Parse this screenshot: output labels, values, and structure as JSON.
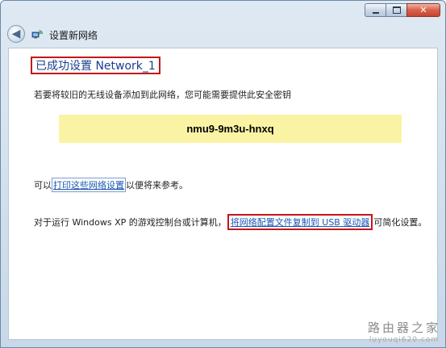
{
  "window": {
    "title": "设置新网络",
    "controls": {
      "minimize": "minimize-icon",
      "maximize": "maximize-icon",
      "close": "close-icon"
    }
  },
  "content": {
    "heading": "已成功设置 Network_1",
    "info": "若要将较旧的无线设备添加到此网络，您可能需要提供此安全密钥",
    "security_key": "nmu9-9m3u-hnxq",
    "print_line": {
      "before": "可以",
      "link": "打印这些网络设置",
      "after": "以便将来参考。"
    },
    "usb_line": {
      "before": "对于运行 Windows XP 的游戏控制台或计算机，",
      "link": "将网络配置文件复制到 USB 驱动器",
      "after": "可简化设置。"
    }
  },
  "watermark": {
    "text": "路由器之家",
    "url": "luyouqi620.com"
  },
  "colors": {
    "heading": "#1a3f8c",
    "link": "#1a56b5",
    "key_background": "#fbf3a4",
    "highlight_border": "#c21818"
  }
}
